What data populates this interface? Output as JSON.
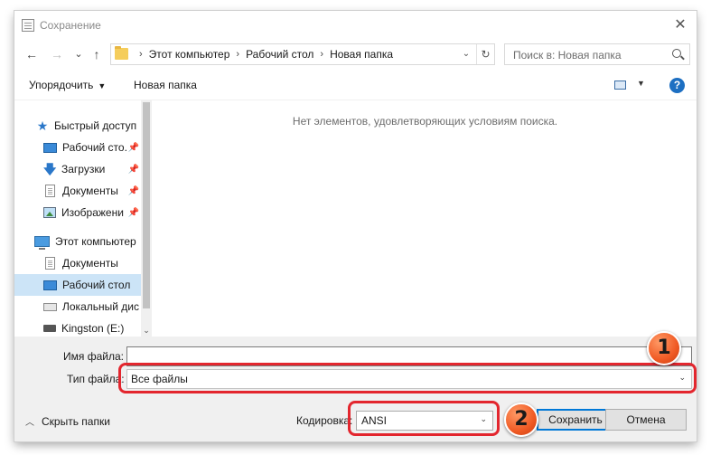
{
  "window": {
    "title": "Сохранение",
    "close_glyph": "✕"
  },
  "navbar": {
    "back_glyph": "←",
    "forward_glyph": "→",
    "recent_glyph": "⌄",
    "up_glyph": "↑",
    "breadcrumbs": [
      "Этот компьютер",
      "Рабочий стол",
      "Новая папка"
    ],
    "crumb_sep": "›",
    "search_placeholder": "Поиск в: Новая папка"
  },
  "toolbar": {
    "organize_label": "Упорядочить",
    "new_folder_label": "Новая папка",
    "help_glyph": "?"
  },
  "tree": {
    "items": [
      {
        "label": "Быстрый доступ",
        "icon": "star-icon"
      },
      {
        "label": "Рабочий сто.",
        "icon": "desktop-icon",
        "pinned": true
      },
      {
        "label": "Загрузки",
        "icon": "download-icon",
        "pinned": true
      },
      {
        "label": "Документы",
        "icon": "document-icon",
        "pinned": true
      },
      {
        "label": "Изображени",
        "icon": "pictures-icon",
        "pinned": true
      },
      {
        "label": "Этот компьютер",
        "icon": "computer-icon"
      },
      {
        "label": "Документы",
        "icon": "document-icon"
      },
      {
        "label": "Рабочий стол",
        "icon": "desktop-icon",
        "selected": true
      },
      {
        "label": "Локальный дис",
        "icon": "drive-icon"
      },
      {
        "label": "Kingston (E:)",
        "icon": "usb-drive-icon"
      }
    ]
  },
  "content": {
    "empty_message": "Нет элементов, удовлетворяющих условиям поиска."
  },
  "form": {
    "filename_label": "Имя файла:",
    "filename_value": "",
    "filetype_label": "Тип файла:",
    "filetype_value": "Все файлы",
    "hide_folders_label": "Скрыть папки",
    "encoding_label": "Кодировка:",
    "encoding_value": "ANSI",
    "save_label": "Сохранить",
    "cancel_label": "Отмена"
  },
  "annotations": {
    "badge_1": "1",
    "badge_2": "2",
    "color": "#e3262e"
  }
}
